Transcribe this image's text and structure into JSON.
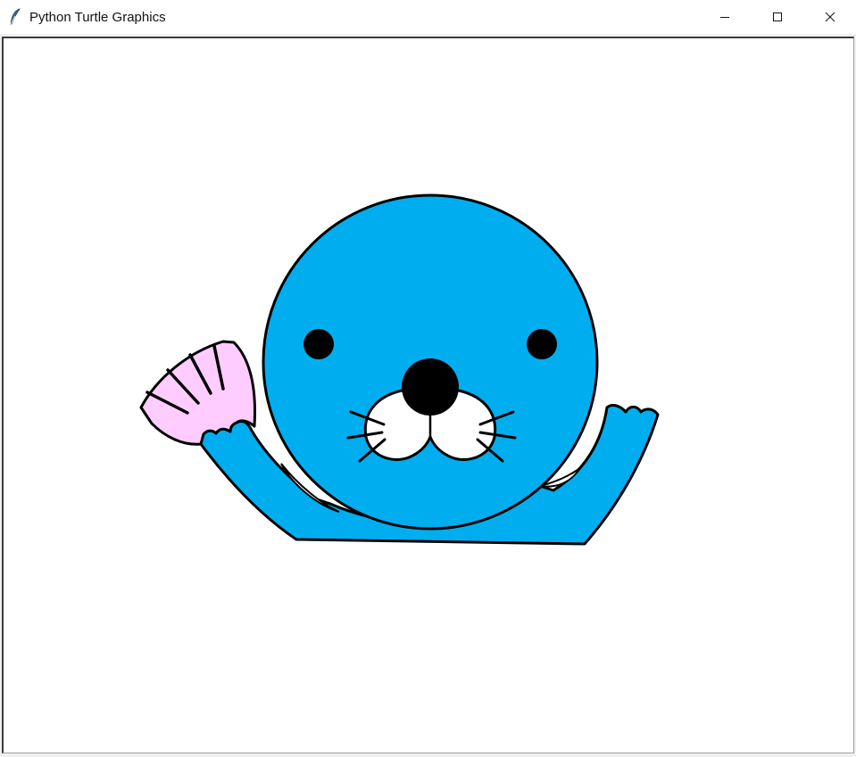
{
  "window": {
    "title": "Python Turtle Graphics",
    "app_icon": "feather-icon",
    "controls": [
      "minimize-icon",
      "maximize-icon",
      "close-icon"
    ]
  },
  "drawing": {
    "subject": "seal holding a seashell",
    "colors": {
      "body": "#00aeef",
      "shell": "#ffccff",
      "outline": "#000000",
      "muzzle": "#ffffff",
      "background": "#ffffff"
    }
  }
}
